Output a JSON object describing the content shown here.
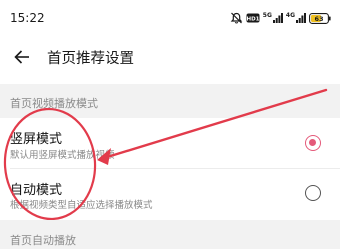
{
  "status_bar": {
    "time": "15:22",
    "hd_label": "HD1",
    "signal1_label": "5G",
    "signal2_label": "4G",
    "battery": "63"
  },
  "header": {
    "back_icon": "arrow-left-icon",
    "title": "首页推荐设置"
  },
  "sections": [
    {
      "label": "首页视频播放模式",
      "options": [
        {
          "title": "竖屏模式",
          "description": "默认用竖屏模式播放视频",
          "selected": true
        },
        {
          "title": "自动模式",
          "description": "根据视频类型自适应选择播放模式",
          "selected": false
        }
      ]
    },
    {
      "label": "首页自动播放"
    }
  ],
  "accent_color": "#e45a7a",
  "annotation_color": "#e23b4b"
}
